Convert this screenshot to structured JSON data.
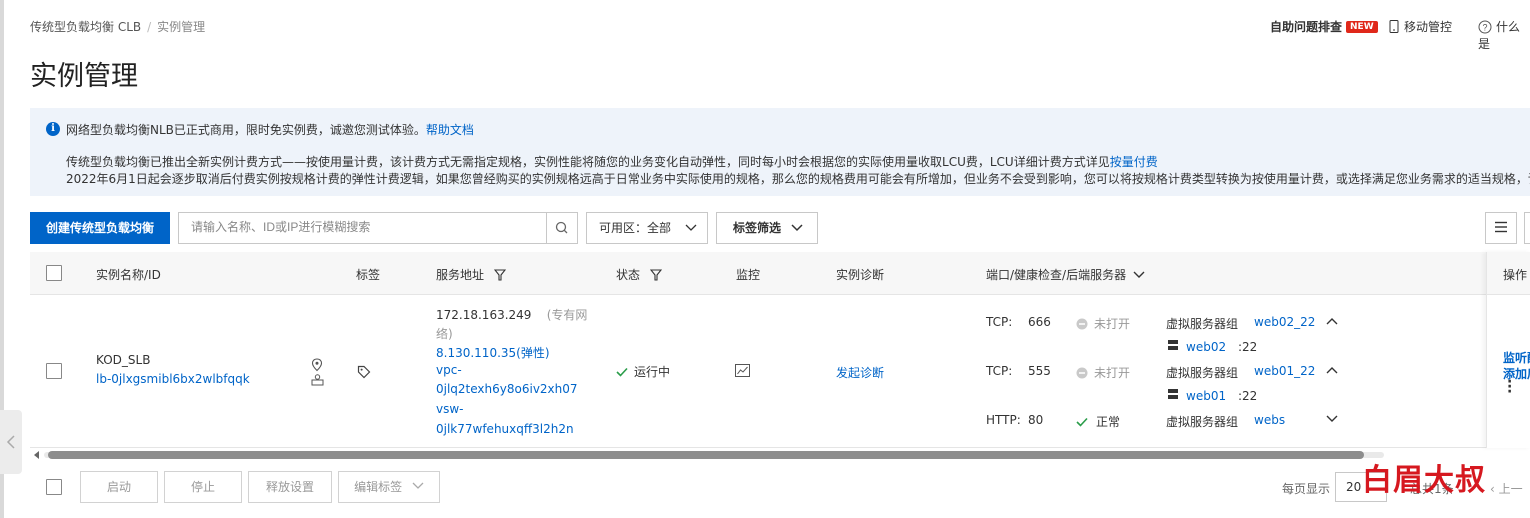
{
  "breadcrumb": {
    "root": "传统型负载均衡 CLB",
    "sep": "/",
    "current": "实例管理"
  },
  "header_links": {
    "self_help": "自助问题排查",
    "new_badge": "NEW",
    "mobile": "移动管控",
    "what": "什么是"
  },
  "page_title": "实例管理",
  "notice": {
    "line1": "网络型负载均衡NLB已正式商用，限时免实例费，诚邀您测试体验。",
    "line1_link": "帮助文档",
    "line2": "传统型负载均衡已推出全新实例计费方式——按使用量计费，该计费方式无需指定规格，实例性能将随您的业务变化自动弹性，同时每小时会根据您的实际使用量收取LCU费，LCU详细计费方式详见",
    "line2_link": "按量付费",
    "line3": "2022年6月1日起会逐步取消后付费实例按规格计费的弹性计费逻辑，如果您曾经购买的实例规格远高于日常业务中实际使用的规格，那么您的规格费用可能会有所增加，但业务不会受到影响，您可以将按规格计费类型转换为按使用量计费，或选择满足您业务需求的适当规格，详"
  },
  "toolbar": {
    "create_label": "创建传统型负载均衡",
    "search_placeholder": "请输入名称、ID或IP进行模糊搜索",
    "zone_label": "可用区：全部",
    "tag_filter_label": "标签筛选"
  },
  "table": {
    "headers": {
      "name": "实例名称/ID",
      "tags": "标签",
      "address": "服务地址",
      "status": "状态",
      "monitor": "监控",
      "diagnosis": "实例诊断",
      "ports": "端口/健康检查/后端服务器",
      "actions": "操作"
    },
    "row": {
      "name": "KOD_SLB",
      "id": "lb-0jlxgsmibl6bx2wlbfqqk",
      "private_ip": "172.18.163.249",
      "private_tag_1": "(专有网",
      "private_tag_2": "络)",
      "public_ip": "8.130.110.35(弹性)",
      "vpc_1": "vpc-",
      "vpc_2": "0jlq2texh6y8o6iv2xh07",
      "vsw_1": "vsw-",
      "vsw_2": "0jlk77wfehuxqff3l2h2n",
      "status": "运行中",
      "diagnosis_link": "发起诊断",
      "listeners": [
        {
          "proto": "TCP:",
          "port": "666",
          "health": "未打开",
          "group_label": "虚拟服务器组",
          "group_name": "web02_22",
          "server": "web02",
          "server_port": ":22"
        },
        {
          "proto": "TCP:",
          "port": "555",
          "health": "未打开",
          "group_label": "虚拟服务器组",
          "group_name": "web01_22",
          "server": "web01",
          "server_port": ":22"
        },
        {
          "proto": "HTTP:",
          "port": "80",
          "health": "正常",
          "group_label": "虚拟服务器组",
          "group_name": "webs"
        }
      ],
      "action_1": "监听配",
      "action_2": "添加后"
    }
  },
  "footer": {
    "start": "启动",
    "stop": "停止",
    "release": "释放设置",
    "edit_tags": "编辑标签",
    "per_page_label": "每页显示",
    "per_page_value": "20",
    "total_text": "总共1条",
    "prev": "上一"
  },
  "watermark": "白眉大叔",
  "colors": {
    "primary": "#0064c8",
    "ok": "#2a9d4a",
    "new_badge": "#e0281a",
    "watermark": "#d6181f"
  }
}
